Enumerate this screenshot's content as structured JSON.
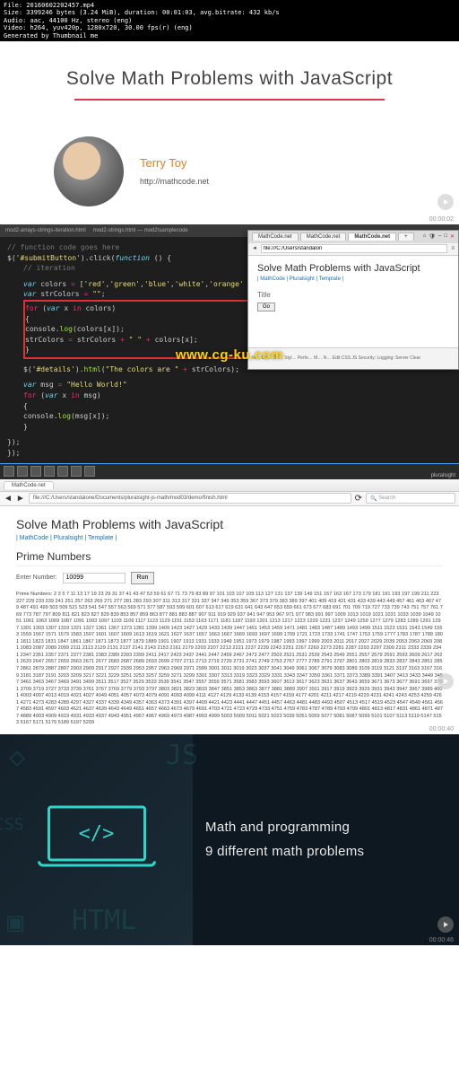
{
  "meta": {
    "file": "File: 20160602202457.mp4",
    "size": "Size: 3399246 bytes (3.24 MiB), duration: 00:01:03, avg.bitrate: 432 kb/s",
    "audio": "Audio: aac, 44100 Hz, stereo (eng)",
    "video": "Video: h264, yuv420p, 1280x720, 30.00 fps(r) (eng)",
    "generated": "Generated by Thumbnail me"
  },
  "panel1": {
    "title": "Solve Math Problems with JavaScript",
    "author_name": "Terry Toy",
    "author_url": "http://mathcode.net",
    "timestamp": "00:00:02"
  },
  "panel2": {
    "editor_tabs": {
      "t1": "mod2-arrays-strings-iteration.html",
      "t2": "mod2-strings.html — mod2\\samplecode"
    },
    "code": {
      "c1": "// function code goes here",
      "c2a": "$(",
      "c2b": "'#submitButton'",
      "c2c": ").click(",
      "c2d": "function",
      "c2e": " () {",
      "c3": "// iteration",
      "c4a": "var",
      "c4b": " colors ",
      "c4c": "=",
      "c4d": " [",
      "c4e": "'red'",
      "c4f": ",",
      "c4g": "'green'",
      "c4h": ",",
      "c4i": "'blue'",
      "c4j": ",",
      "c4k": "'white'",
      "c4l": ",",
      "c4m": "'orange'",
      "c4n": "];",
      "c5a": "var",
      "c5b": " strColors ",
      "c5c": "=",
      "c5d": " ",
      "c5e": "\"\"",
      "c5f": ";",
      "c6a": "for",
      "c6b": " (",
      "c6c": "var",
      "c6d": " x ",
      "c6e": "in",
      "c6f": " colors)",
      "c7": "{",
      "c8a": "    console.",
      "c8b": "log",
      "c8c": "(colors[x]);",
      "c9a": "    strColors ",
      "c9b": "=",
      "c9c": " strColors ",
      "c9d": "+",
      "c9e": " ",
      "c9f": "\" \"",
      "c9g": " ",
      "c9h": "+",
      "c9i": " colors[x];",
      "c10": "}",
      "c11a": "$(",
      "c11b": "'#details'",
      "c11c": ").",
      "c11d": "html",
      "c11e": "(",
      "c11f": "\"The colors are \"",
      "c11g": " ",
      "c11h": "+",
      "c11i": " strColors);",
      "c12a": "var",
      "c12b": " msg ",
      "c12c": "=",
      "c12d": " ",
      "c12e": "\"Hello World!\"",
      "c13a": "for",
      "c13b": " (",
      "c13c": "var",
      "c13d": " x ",
      "c13e": "in",
      "c13f": " msg)",
      "c14": "{",
      "c15a": "    console.",
      "c15b": "log",
      "c15c": "(msg[x]);",
      "c16": "}",
      "c17": "});",
      "c18": "});"
    },
    "browser": {
      "tabs": {
        "t1": "MathCode.net",
        "t2": "MathCode.net",
        "t3": "MathCode.net"
      },
      "addr": "file:///C:/Users/standalon",
      "h1": "Solve Math Problems with JavaScript",
      "links": "| MathCode | Pluralsight | Template |",
      "title_label": "Title",
      "go": "Go",
      "dev": "In…  Co…  De…  Styl…  Perfo…  M…  N…  Edit  CSS  JS  Security:  Logging:  Server  Clear"
    },
    "watermark": "www.cg-ku.com",
    "taskbar_brand": "pluralsight"
  },
  "panel3": {
    "tab": "MathCode.net",
    "url": "file:///C:/Users/standalone/Documents/pluralsight-js-math/mod03/demo/finish.html",
    "search_placeholder": "Search",
    "h1": "Solve Math Problems with JavaScript",
    "links": "| MathCode | Pluralsight | Template |",
    "h2": "Prime Numbers",
    "input_label": "Enter Number:",
    "input_value": "10099",
    "run_label": "Run",
    "primes_label": "Prime Numbers:",
    "primes_values": "2 3 5 7 11 13 17 19 23 29 31 37 41 43 47 53 59 61 67 71 73 79 83 89 97 101 103 107 109 113 127 131 137 139 149 151 157 163 167 173 179 181 191 193 197 199 211 223 227 229 233 239 241 251 257 263 269 271 277 281 283 293 307 311 313 317 331 337 347 349 353 359 367 373 379 383 389 397 401 409 419 421 431 433 439 443 449 457 461 463 467 479 487 491 499 503 509 521 523 541 547 557 563 569 571 577 587 593 599 601 607 613 617 619 631 641 643 647 653 659 661 673 677 683 691 701 709 719 727 733 739 743 751 757 761 769 773 787 797 809 811 821 823 827 829 839 853 857 859 863 877 881 883 887 907 911 919 929 937 941 947 953 967 971 977 983 991 997 1009 1013 1019 1021 1031 1033 1039 1049 1051 1061 1063 1069 1087 1091 1093 1097 1103 1109 1117 1123 1129 1151 1153 1163 1171 1181 1187 1193 1201 1213 1217 1223 1229 1231 1237 1249 1259 1277 1279 1283 1289 1291 1297 1301 1303 1307 1319 1321 1327 1361 1367 1373 1381 1399 1409 1423 1427 1429 1433 1439 1447 1451 1453 1459 1471 1481 1483 1487 1489 1493 1499 1511 1523 1531 1543 1549 1553 1559 1567 1571 1579 1583 1597 1601 1607 1609 1613 1619 1621 1627 1637 1657 1663 1667 1669 1693 1697 1699 1709 1721 1723 1733 1741 1747 1753 1759 1777 1783 1787 1789 1801 1811 1823 1831 1847 1861 1867 1871 1873 1877 1879 1889 1901 1907 1913 1931 1933 1949 1951 1973 1979 1987 1993 1997 1999 2003 2011 2017 2027 2029 2039 2053 2063 2069 2081 2083 2087 2089 2099 2111 2113 2129 2131 2137 2141 2143 2153 2161 2179 2203 2207 2213 2221 2237 2239 2243 2251 2267 2269 2273 2281 2287 2293 2297 2309 2311 2333 2339 2341 2347 2351 2357 2371 2377 2381 2383 2389 2393 2399 2411 2417 2423 2437 2441 2447 2459 2467 2473 2477 2503 2521 2531 2539 2543 2549 2551 2557 2579 2591 2593 2609 2617 2621 2633 2647 2657 2659 2663 2671 2677 2683 2687 2689 2693 2699 2707 2711 2713 2719 2729 2731 2741 2749 2753 2767 2777 2789 2791 2797 2801 2803 2819 2833 2837 2843 2851 2857 2861 2879 2887 2897 2903 2909 2917 2927 2939 2953 2957 2963 2969 2971 2999 3001 3011 3019 3023 3037 3041 3049 3061 3067 3079 3083 3089 3109 3119 3121 3137 3163 3167 3169 3181 3187 3191 3203 3209 3217 3221 3229 3251 3253 3257 3259 3271 3299 3301 3307 3313 3319 3323 3329 3331 3343 3347 3359 3361 3371 3373 3389 3391 3407 3413 3433 3449 3457 3461 3463 3467 3469 3491 3499 3511 3517 3527 3529 3533 3539 3541 3547 3557 3559 3571 3581 3583 3593 3607 3613 3617 3623 3631 3637 3643 3659 3671 3673 3677 3691 3697 3701 3709 3719 3727 3733 3739 3761 3767 3769 3779 3793 3797 3803 3821 3823 3833 3847 3851 3853 3863 3877 3881 3889 3907 3911 3917 3919 3923 3929 3931 3943 3947 3967 3989 4001 4003 4007 4013 4019 4021 4027 4049 4051 4057 4073 4079 4091 4093 4099 4111 4127 4129 4133 4139 4153 4157 4159 4177 4201 4211 4217 4219 4229 4231 4241 4243 4253 4259 4261 4271 4273 4283 4289 4297 4327 4337 4339 4349 4357 4363 4373 4391 4397 4409 4421 4423 4441 4447 4451 4457 4463 4481 4483 4493 4507 4513 4517 4519 4523 4547 4549 4561 4567 4583 4591 4597 4603 4621 4637 4639 4643 4649 4651 4657 4663 4673 4679 4691 4703 4721 4723 4729 4733 4751 4759 4783 4787 4789 4793 4799 4801 4813 4817 4831 4861 4871 4877 4889 4903 4909 4919 4931 4933 4937 4943 4951 4957 4967 4969 4973 4987 4993 4999 5003 5009 5011 5021 5023 5039 5051 5059 5077 5081 5087 5099 5101 5107 5113 5119 5147 5153 5167 5171 5179 5189 5197 5209",
    "timestamp": "00:00:40"
  },
  "panel4": {
    "line1": "Math and programming",
    "line2": "9 different math problems",
    "code_glyph": "</>",
    "timestamp": "00:00:46"
  }
}
